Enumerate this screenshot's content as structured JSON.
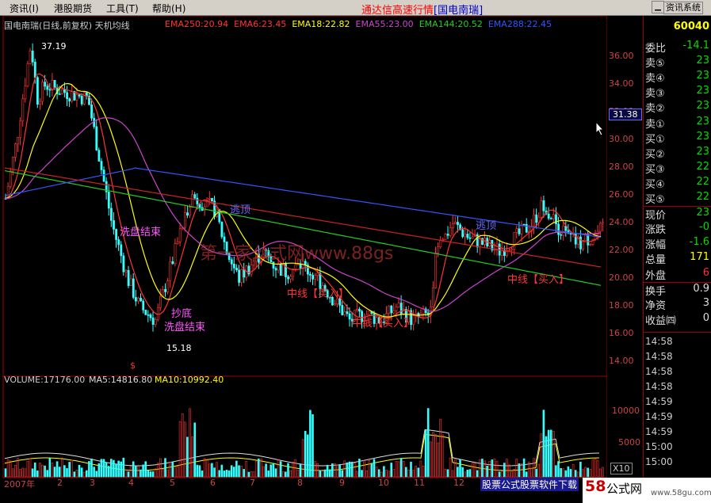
{
  "menu": {
    "items": [
      "资讯(I)",
      "港股期货",
      "工具(T)",
      "帮助(H)"
    ],
    "title": "通达信高速行情",
    "stock_tag": "[国电南瑞]",
    "right_button": "资讯系统"
  },
  "chart": {
    "header": "国电南瑞(日线,前复权) 天机均线",
    "ema": [
      {
        "label": "EMA250:20.94",
        "color": "#ff3333"
      },
      {
        "label": "EMA6:23.45",
        "color": "#ff3333"
      },
      {
        "label": "EMA18:22.82",
        "color": "#ffff00"
      },
      {
        "label": "EMA55:23.00",
        "color": "#cc44cc"
      },
      {
        "label": "EMA144:20.52",
        "color": "#22cc22"
      },
      {
        "label": "EMA288:22.45",
        "color": "#3355ff"
      }
    ],
    "price_axis": [
      "36.00",
      "34.00",
      "32.00",
      "30.00",
      "28.00",
      "26.00",
      "24.00",
      "22.00",
      "20.00",
      "18.00",
      "16.00",
      "14.00"
    ],
    "current_price_tag": "31.38",
    "annotations": {
      "high": "37.19",
      "low": "15.18",
      "wash_end_1": "洗盘结束",
      "wash_end_2": "洗盘结束",
      "buy_bottom": "抄底",
      "escape_1": "逃顶",
      "escape_2": "逃顶",
      "mid_line_1": "中线",
      "mid_buy_1": "【买入】",
      "mid_line_2": "中线",
      "mid_buy_2": "【买入】",
      "mid_line_3": "中线",
      "mid_buy_3": "【买入】",
      "watermark": "第一家公式网www.88gs"
    },
    "volume_header": {
      "vol": "VOLUME:17176.00",
      "ma5": "MA5:14816.80",
      "ma10": "MA10:10992.40"
    },
    "volume_axis": [
      "10000",
      "5000"
    ],
    "volume_unit": "X10",
    "months": [
      "2007年",
      "2",
      "3",
      "4",
      "5",
      "6",
      "7",
      "8",
      "9",
      "10",
      "11",
      "12"
    ],
    "bottom_banner": "股票公式股票软件下载"
  },
  "quote_panel": {
    "code": "60040",
    "rows": [
      {
        "k": "委比",
        "v": "-14.1",
        "color": "#00dd00"
      },
      {
        "k": "卖⑤",
        "v": "23",
        "color": "#00dd00"
      },
      {
        "k": "卖④",
        "v": "23",
        "color": "#00dd00"
      },
      {
        "k": "卖③",
        "v": "23",
        "color": "#00dd00"
      },
      {
        "k": "卖②",
        "v": "23",
        "color": "#00dd00"
      },
      {
        "k": "卖①",
        "v": "23",
        "color": "#00dd00"
      },
      {
        "k": "买①",
        "v": "23",
        "color": "#00dd00"
      },
      {
        "k": "买②",
        "v": "23",
        "color": "#00dd00"
      },
      {
        "k": "买③",
        "v": "22",
        "color": "#00dd00"
      },
      {
        "k": "买④",
        "v": "22",
        "color": "#00dd00"
      },
      {
        "k": "买⑤",
        "v": "22",
        "color": "#00dd00"
      },
      {
        "k": "现价",
        "v": "23",
        "color": "#00dd00"
      },
      {
        "k": "涨跌",
        "v": "-0",
        "color": "#00dd00"
      },
      {
        "k": "涨幅",
        "v": "-1.6",
        "color": "#00dd00"
      },
      {
        "k": "总量",
        "v": "171",
        "color": "#ffff00"
      },
      {
        "k": "外盘",
        "v": "6",
        "color": "#ff3333"
      },
      {
        "k": "换手",
        "v": "0.9",
        "color": "#dddddd"
      },
      {
        "k": "净资",
        "v": "3",
        "color": "#dddddd"
      },
      {
        "k": "收益㈣",
        "v": "0",
        "color": "#dddddd"
      }
    ],
    "ticks": [
      "14:58",
      "14:58",
      "14:58",
      "14:58",
      "14:59",
      "14:59",
      "14:59",
      "15:00",
      "15:00"
    ]
  },
  "logo": {
    "mark": "58",
    "text": "公式网",
    "url": "www.58gu.com"
  }
}
